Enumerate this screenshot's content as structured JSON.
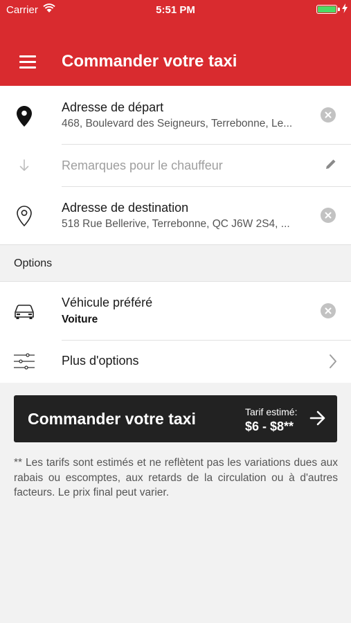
{
  "status_bar": {
    "carrier": "Carrier",
    "time": "5:51 PM",
    "battery_color": "#4cd964"
  },
  "header": {
    "title": "Commander votre taxi",
    "menu_icon": "hamburger-icon",
    "background": "#d92b2f"
  },
  "pickup": {
    "icon": "map-pin-filled-icon",
    "label": "Adresse de départ",
    "value": "468, Boulevard des Seigneurs, Terrebonne, Le..."
  },
  "remarks": {
    "icon": "arrow-down-icon",
    "placeholder": "Remarques pour le chauffeur",
    "edit_icon": "pencil-icon"
  },
  "destination": {
    "icon": "map-pin-outline-icon",
    "label": "Adresse de destination",
    "value": "518 Rue Bellerive, Terrebonne, QC J6W 2S4, ..."
  },
  "options_section": {
    "title": "Options"
  },
  "vehicle": {
    "icon": "car-icon",
    "label": "Véhicule préféré",
    "value": "Voiture"
  },
  "more_options": {
    "icon": "sliders-icon",
    "label": "Plus d'options"
  },
  "order_button": {
    "label": "Commander votre taxi",
    "fare_title": "Tarif estimé:",
    "fare": "$6 - $8**"
  },
  "disclaimer": "** Les tarifs sont estimés et ne reflètent pas les variations dues aux rabais ou escomptes, aux retards de la circulation ou à d'autres facteurs. Le prix final peut varier."
}
